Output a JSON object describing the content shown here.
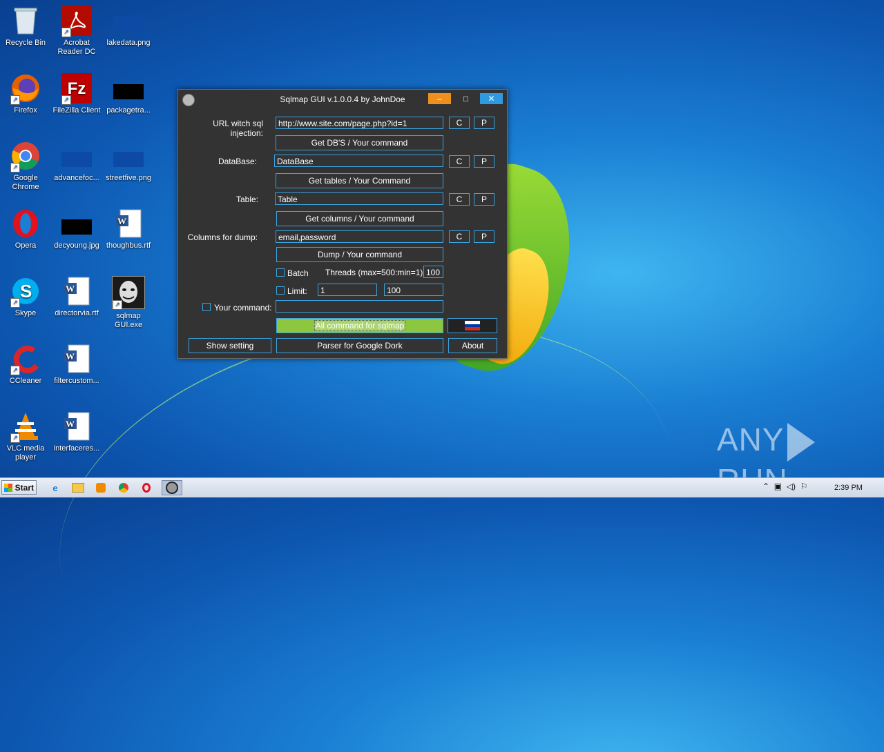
{
  "desktop": {
    "icons": [
      {
        "label": "Recycle Bin"
      },
      {
        "label": "Acrobat Reader DC"
      },
      {
        "label": "lakedata.png"
      },
      {
        "label": "Firefox"
      },
      {
        "label": "FileZilla Client"
      },
      {
        "label": "packagetra..."
      },
      {
        "label": "Google Chrome"
      },
      {
        "label": "advancefoc..."
      },
      {
        "label": "streetfive.png"
      },
      {
        "label": "Opera"
      },
      {
        "label": "decyoung.jpg"
      },
      {
        "label": "thoughbus.rtf"
      },
      {
        "label": "Skype"
      },
      {
        "label": "directorvia.rtf"
      },
      {
        "label": "sqlmap GUI.exe"
      },
      {
        "label": "CCleaner"
      },
      {
        "label": "filtercustom..."
      },
      {
        "label": "VLC media player"
      },
      {
        "label": "interfaceres..."
      }
    ],
    "watermark": "ANY RUN"
  },
  "window": {
    "title": "Sqlmap GUI v.1.0.0.4 by JohnDoe",
    "minimize": "‒",
    "maximize": "□",
    "close": "✕",
    "url_label": "URL witch sql injection:",
    "url_value": "http://www.site.com/page.php?id=1",
    "c_label": "C",
    "p_label": "P",
    "get_dbs_button": "Get DB'S / Your command",
    "database_label": "DataBase:",
    "database_value": "DataBase",
    "get_tables_button": "Get tables / Your Command",
    "table_label": "Table:",
    "table_value": "Table",
    "get_columns_button": "Get columns / Your command",
    "columns_label": "Columns for dump:",
    "columns_value": "email,password",
    "dump_button": "Dump / Your command",
    "batch_label": "Batch",
    "threads_label": "Threads (max=500:min=1)  :",
    "threads_value": "100",
    "limit_label": "Limit:",
    "limit_from": "1",
    "limit_to": "100",
    "your_command_label": "Your command:",
    "your_command_value": "",
    "all_command_button": "All command for sqlmap",
    "show_setting_button": "Show setting",
    "parser_button": "Parser for Google Dork",
    "about_button": "About"
  },
  "taskbar": {
    "start_label": "Start",
    "clock": "2:39 PM"
  },
  "colors": {
    "accent": "#3aa3e3",
    "window_bg": "#333333",
    "green_button": "#8dc63f",
    "minimize": "#f0901c",
    "close": "#2f9ae0"
  }
}
